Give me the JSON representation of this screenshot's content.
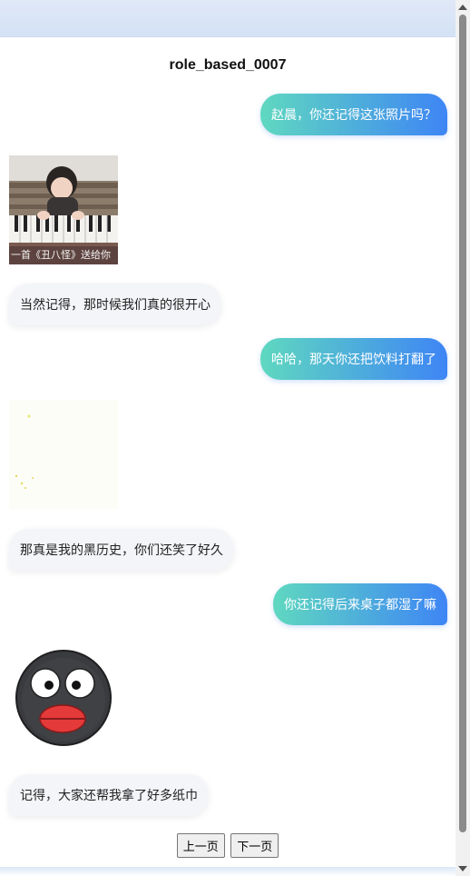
{
  "title": "role_based_0007",
  "messages": [
    {
      "side": "right",
      "text": "赵晨，你还记得这张照片吗？"
    },
    {
      "side": "left",
      "type": "image",
      "caption": "一首《丑八怪》送给你"
    },
    {
      "side": "left",
      "text": "当然记得，那时候我们真的很开心"
    },
    {
      "side": "right",
      "text": "哈哈，那天你还把饮料打翻了"
    },
    {
      "side": "left",
      "type": "image"
    },
    {
      "side": "left",
      "text": "那真是我的黑历史，你们还笑了好久"
    },
    {
      "side": "right",
      "text": "你还记得后来桌子都湿了嘛"
    },
    {
      "side": "left",
      "type": "sticker"
    },
    {
      "side": "left",
      "text": "记得，大家还帮我拿了好多纸巾"
    }
  ],
  "pager": {
    "prev_label": "上一页",
    "next_label": "下一页"
  },
  "colors": {
    "bubble_gradient_start": "#5fd8c0",
    "bubble_gradient_end": "#3e85f5",
    "left_bubble_bg": "#f3f5f8"
  }
}
